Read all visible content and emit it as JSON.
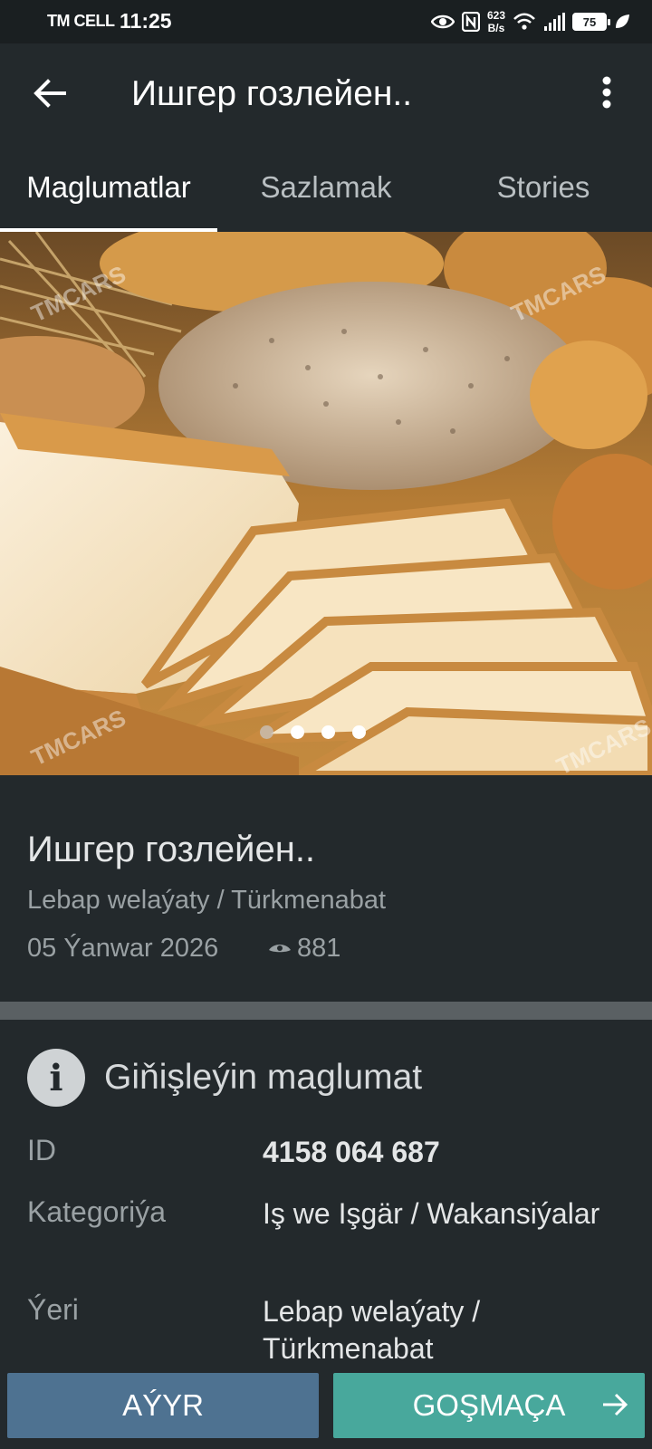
{
  "status_bar": {
    "carrier": "TM CELL",
    "time": "11:25",
    "speed_value": "623",
    "speed_unit": "B/s",
    "battery": "75"
  },
  "app_bar": {
    "title": "Ишгер гозлейен..",
    "back_icon": "arrow-left-icon",
    "menu_icon": "more-vert-icon"
  },
  "tabs": [
    {
      "label": "Maglumatlar",
      "active": true
    },
    {
      "label": "Sazlamak",
      "active": false
    },
    {
      "label": "Stories",
      "active": false
    }
  ],
  "carousel": {
    "watermark": "TMCARS",
    "pages": 4,
    "current_page": 1
  },
  "listing": {
    "title": "Ишгер гозлейен..",
    "location": "Lebap welaýaty / Türkmenabat",
    "date": "05 Ýanwar 2026",
    "views": "881"
  },
  "details": {
    "heading": "Giňişleýin maglumat",
    "rows": [
      {
        "label": "ID",
        "value": "4158 064 687"
      },
      {
        "label": "Kategoriýa",
        "value": "Iş we Işgär / Wakansiýalar"
      },
      {
        "label": "Ýeri",
        "value": "Lebap welaýaty / Türkmenabat"
      }
    ]
  },
  "actions": {
    "remove_label": "AÝYR",
    "add_label": "GOŞMAÇA"
  },
  "colors": {
    "background": "#23292c",
    "remove_button": "#4e7291",
    "add_button": "#48a89c",
    "divider": "#5a6063"
  }
}
